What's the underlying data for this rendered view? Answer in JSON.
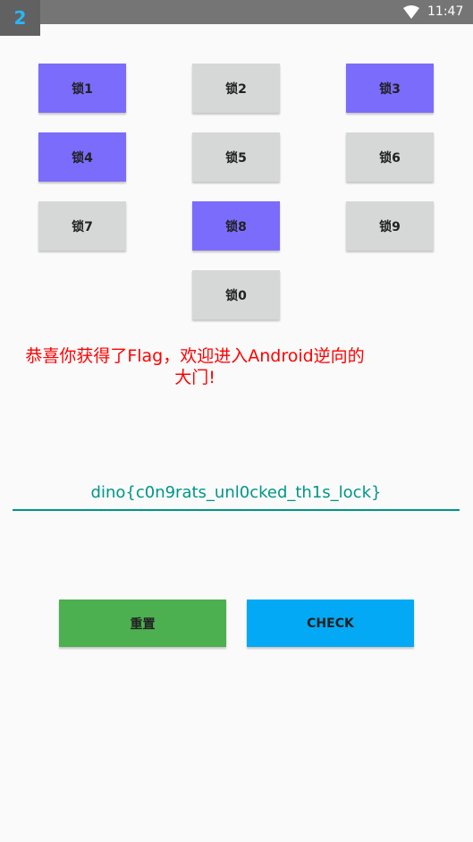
{
  "status_bar": {
    "app_badge": "2",
    "time": "11:47",
    "wifi_icon": "wifi-icon"
  },
  "locks": [
    {
      "label": "锁1",
      "active": true
    },
    {
      "label": "锁2",
      "active": false
    },
    {
      "label": "锁3",
      "active": true
    },
    {
      "label": "锁4",
      "active": true
    },
    {
      "label": "锁5",
      "active": false
    },
    {
      "label": "锁6",
      "active": false
    },
    {
      "label": "锁7",
      "active": false
    },
    {
      "label": "锁8",
      "active": true
    },
    {
      "label": "锁9",
      "active": false
    },
    {
      "label": "锁0",
      "active": false
    }
  ],
  "message": {
    "line1": "恭喜你获得了Flag，欢迎进入Android逆向的",
    "line2": "大门!"
  },
  "flag_input": {
    "value": "dino{c0n9rats_unl0cked_th1s_lock}"
  },
  "actions": {
    "reset_label": "重置",
    "check_label": "CHECK"
  },
  "colors": {
    "lock_active": "#7b6cfc",
    "lock_inactive": "#d6d7d7",
    "message": "#ff0000",
    "accent": "#009688",
    "reset": "#4caf50",
    "check": "#03a9f4"
  }
}
